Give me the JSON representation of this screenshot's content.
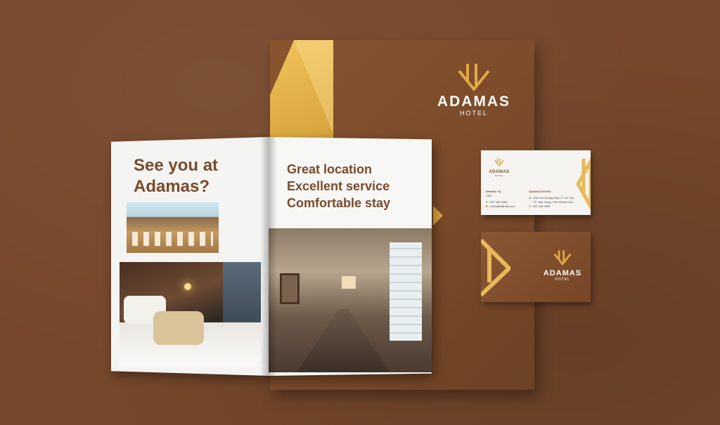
{
  "brand": {
    "name": "ADAMAS",
    "sub": "HOTEL"
  },
  "magazine": {
    "left_heading_1": "See you at",
    "left_heading_2": "Adamas?",
    "right_lines": [
      "Great location",
      "Excellent service",
      "Comfortable stay"
    ]
  },
  "business_card": {
    "person_name": "NHƯNG TẠ",
    "person_title": "CEO",
    "phone_label": "T :",
    "phone": "097 348 3398",
    "email_label": "E :",
    "email": "hello@adamas.com",
    "company": "ADAMAS HOTEL",
    "address_label": "A :",
    "address_line1": "20A Tôn Quang Khải, P. Lộc Thọ,",
    "address_line2": "TP. Nha Trang, Tỉnh Khánh Hoà",
    "company_phone_label": "T :",
    "company_phone": "097 348 3398"
  },
  "colors": {
    "background": "#76472b",
    "gold": "#e0aa45",
    "brown": "#7a4a2a"
  },
  "icons": [
    "adamas-logo-icon",
    "gold-emblem-icon"
  ]
}
